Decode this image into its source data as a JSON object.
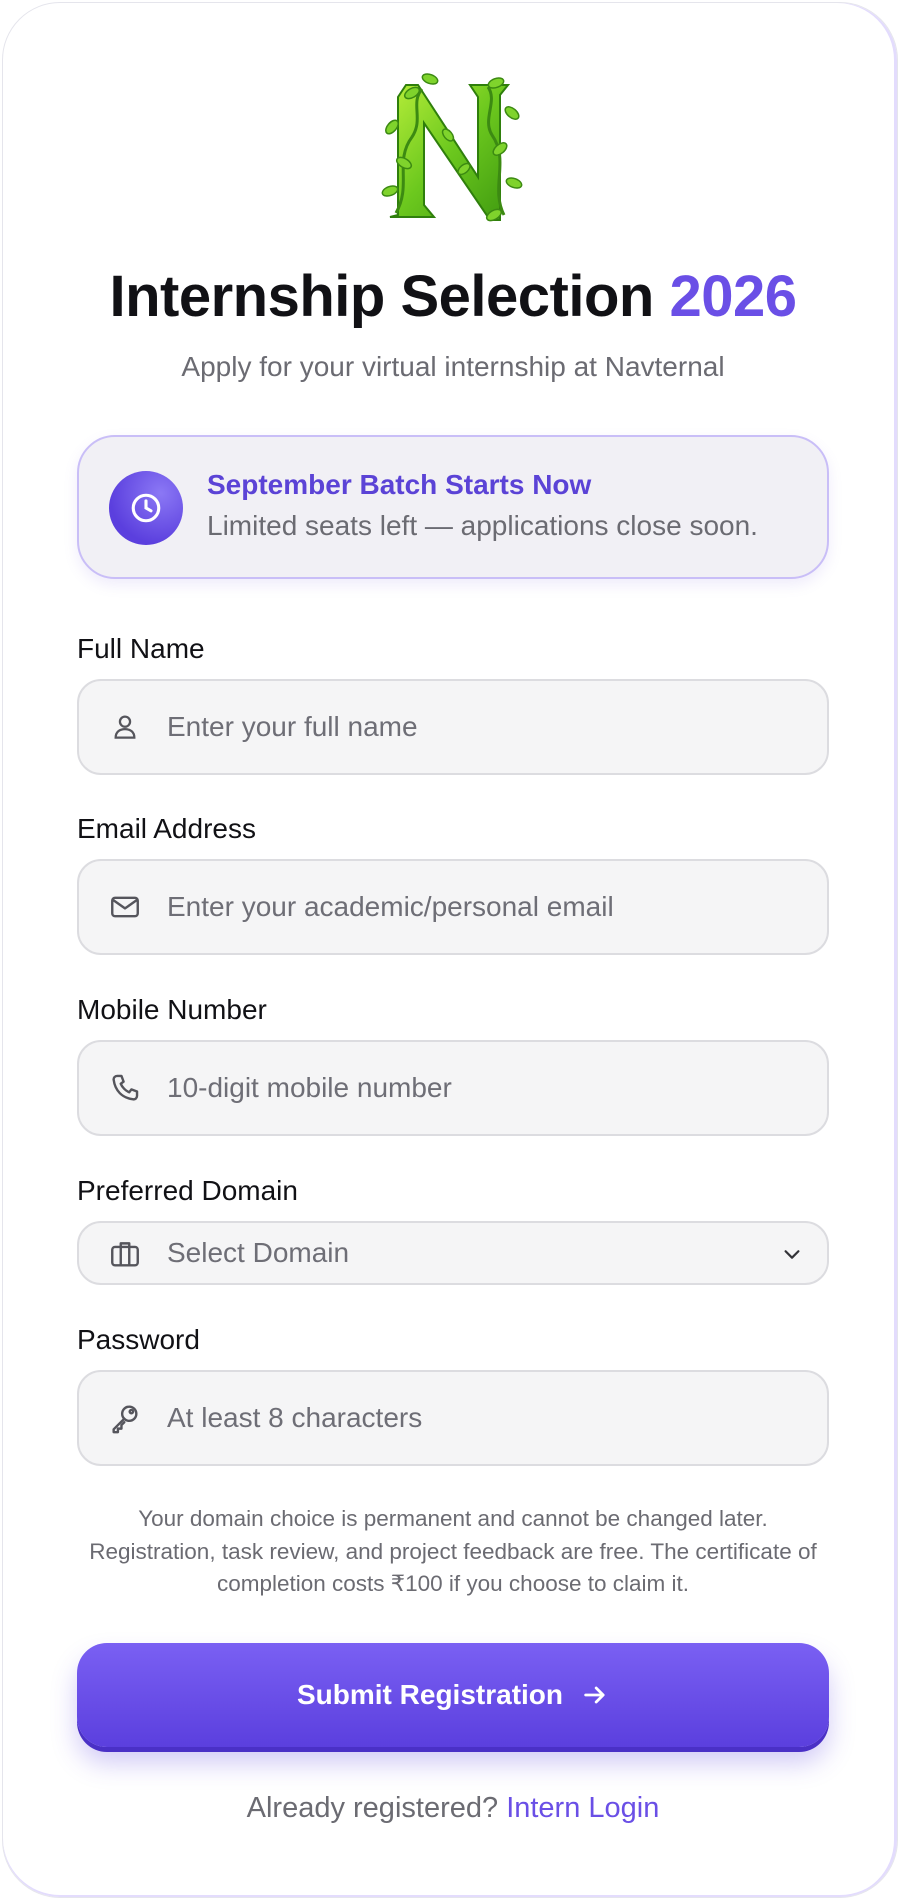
{
  "header": {
    "title_main": "Internship Selection",
    "title_year": "2026",
    "subtitle": "Apply for your virtual internship at Navternal"
  },
  "banner": {
    "icon": "clock-icon",
    "title": "September Batch Starts Now",
    "text": "Limited seats left — applications close soon."
  },
  "form": {
    "full_name": {
      "label": "Full Name",
      "icon": "user-icon",
      "placeholder": "Enter your full name",
      "value": ""
    },
    "email": {
      "label": "Email Address",
      "icon": "mail-icon",
      "placeholder": "Enter your academic/personal email",
      "value": ""
    },
    "mobile": {
      "label": "Mobile Number",
      "icon": "phone-icon",
      "placeholder": "10-digit mobile number",
      "value": ""
    },
    "domain": {
      "label": "Preferred Domain",
      "icon": "briefcase-icon",
      "selected": "Select Domain"
    },
    "password": {
      "label": "Password",
      "icon": "key-icon",
      "placeholder": "At least 8 characters",
      "value": ""
    }
  },
  "note": "Your domain choice is permanent and cannot be changed later. Registration, task review, and project feedback are free. The certificate of completion costs ₹100 if you choose to claim it.",
  "submit": {
    "label": "Submit Registration",
    "icon": "arrow-right-icon"
  },
  "footer": {
    "prompt": "Already registered?",
    "link": "Intern Login"
  },
  "colors": {
    "accent": "#6a4fe6",
    "button": "#5b3fde",
    "text": "#111115",
    "muted": "#6b6b72"
  }
}
